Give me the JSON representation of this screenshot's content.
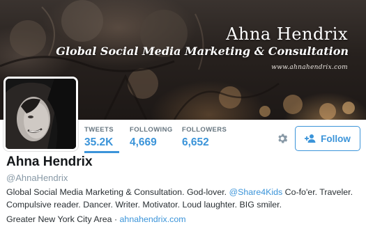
{
  "banner": {
    "title": "Ahna Hendrix",
    "subtitle": "Global Social Media Marketing & Consultation",
    "url": "www.ahnahendrix.com"
  },
  "stats": {
    "tweets": {
      "label": "TWEETS",
      "value": "35.2K"
    },
    "following": {
      "label": "FOLLOWING",
      "value": "4,669"
    },
    "followers": {
      "label": "FOLLOWERS",
      "value": "6,652"
    }
  },
  "actions": {
    "follow_label": "Follow",
    "gear_icon": "gear-icon",
    "follow_icon": "add-user-icon"
  },
  "profile": {
    "name": "Ahna Hendrix",
    "handle": "@AhnaHendrix",
    "bio": {
      "part1": "Global Social Media Marketing & Consultation. God-lover. ",
      "mention": "@Share4Kids",
      "part2": " Co-fo'er. Traveler. Compulsive reader. Dancer. Writer. Motivator. Loud laughter. BIG smiler."
    },
    "location": "Greater New York City Area",
    "separator": " · ",
    "website": "ahnahendrix.com"
  },
  "colors": {
    "accent": "#3b94d9",
    "text": "#292f33",
    "muted": "#8899a6",
    "label": "#66757f"
  }
}
